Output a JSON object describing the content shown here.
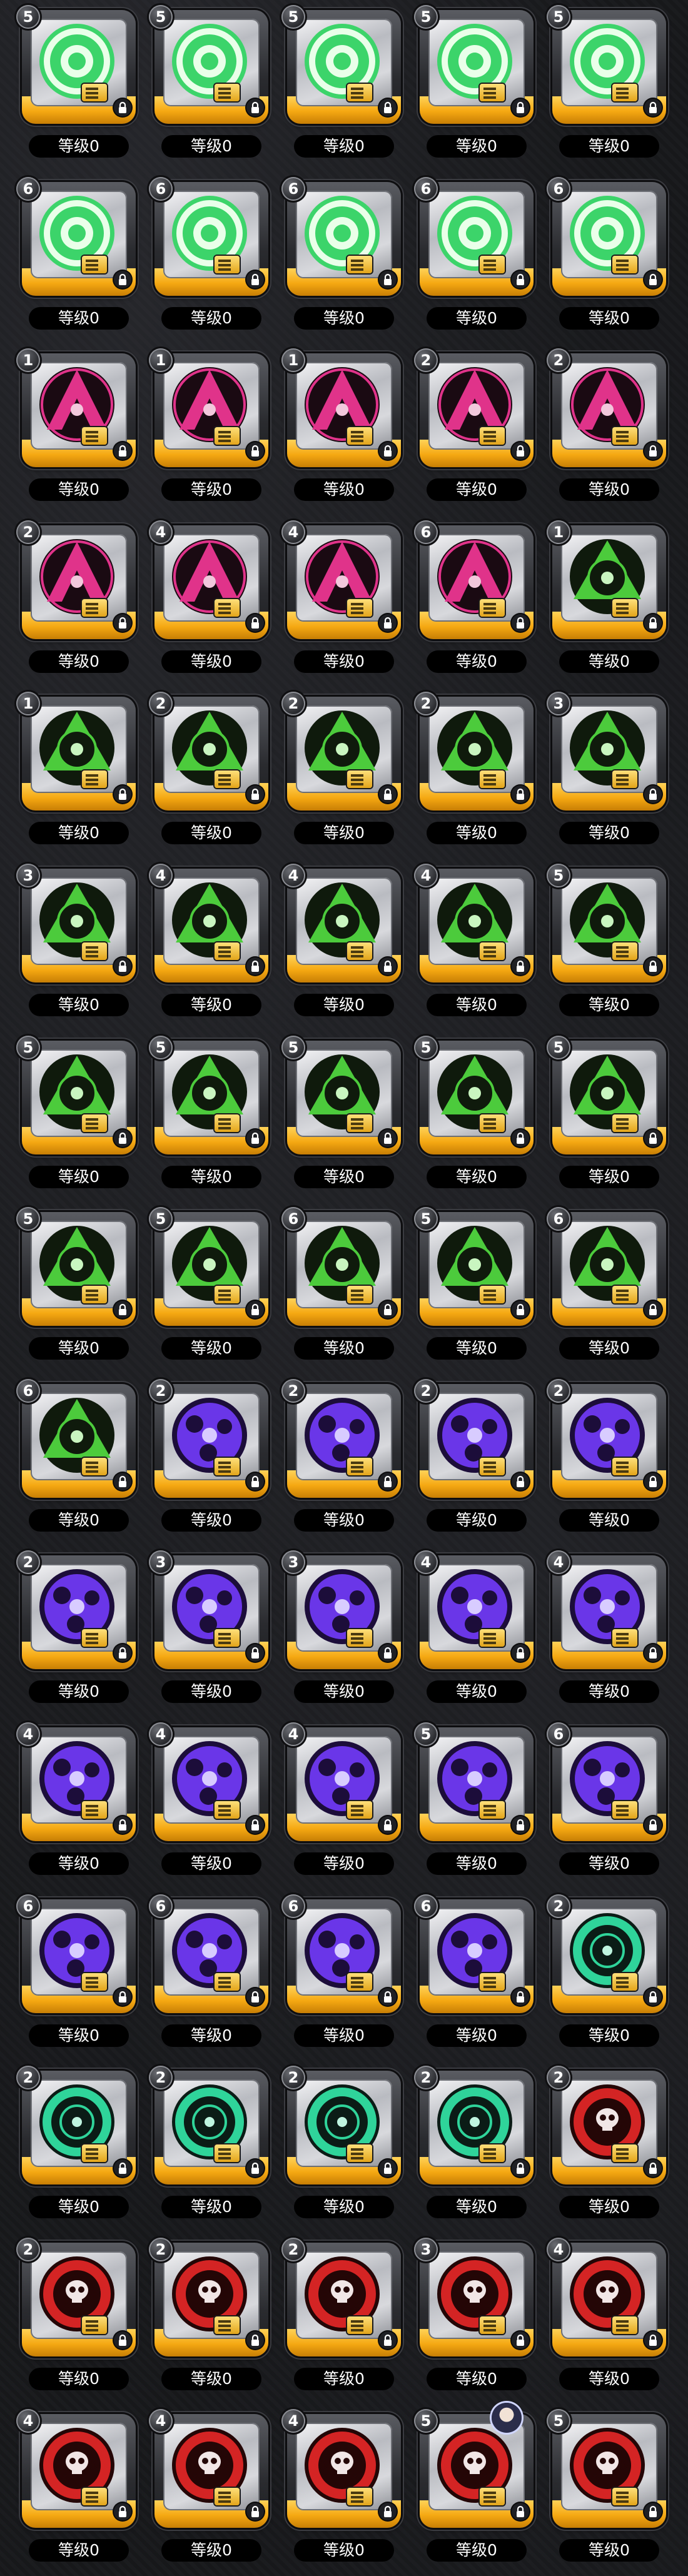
{
  "level_label": "等级0",
  "colors": {
    "green": "#3cd46a",
    "pink": "#e0338a",
    "lime": "#4ccb3c",
    "purple": "#6a36e8",
    "teal": "#2fd49a",
    "red": "#d42424"
  },
  "items": [
    {
      "badge": "5",
      "color": "green",
      "design": "plain",
      "level": "等级0"
    },
    {
      "badge": "5",
      "color": "green",
      "design": "plain",
      "level": "等级0"
    },
    {
      "badge": "5",
      "color": "green",
      "design": "plain",
      "level": "等级0"
    },
    {
      "badge": "5",
      "color": "green",
      "design": "plain",
      "level": "等级0"
    },
    {
      "badge": "5",
      "color": "green",
      "design": "plain",
      "level": "等级0"
    },
    {
      "badge": "6",
      "color": "green",
      "design": "plain",
      "level": "等级0"
    },
    {
      "badge": "6",
      "color": "green",
      "design": "plain",
      "level": "等级0"
    },
    {
      "badge": "6",
      "color": "green",
      "design": "plain",
      "level": "等级0"
    },
    {
      "badge": "6",
      "color": "green",
      "design": "plain",
      "level": "等级0"
    },
    {
      "badge": "6",
      "color": "green",
      "design": "plain",
      "level": "等级0"
    },
    {
      "badge": "1",
      "color": "pink",
      "design": "arrow",
      "level": "等级0"
    },
    {
      "badge": "1",
      "color": "pink",
      "design": "arrow",
      "level": "等级0"
    },
    {
      "badge": "1",
      "color": "pink",
      "design": "arrow",
      "level": "等级0"
    },
    {
      "badge": "2",
      "color": "pink",
      "design": "arrow",
      "level": "等级0"
    },
    {
      "badge": "2",
      "color": "pink",
      "design": "arrow",
      "level": "等级0"
    },
    {
      "badge": "2",
      "color": "pink",
      "design": "arrow",
      "level": "等级0"
    },
    {
      "badge": "4",
      "color": "pink",
      "design": "arrow",
      "level": "等级0"
    },
    {
      "badge": "4",
      "color": "pink",
      "design": "arrow",
      "level": "等级0"
    },
    {
      "badge": "6",
      "color": "pink",
      "design": "arrow",
      "level": "等级0"
    },
    {
      "badge": "1",
      "color": "lime",
      "design": "tri",
      "level": "等级0"
    },
    {
      "badge": "1",
      "color": "lime",
      "design": "tri",
      "level": "等级0"
    },
    {
      "badge": "2",
      "color": "lime",
      "design": "tri",
      "level": "等级0"
    },
    {
      "badge": "2",
      "color": "lime",
      "design": "tri",
      "level": "等级0"
    },
    {
      "badge": "2",
      "color": "lime",
      "design": "tri",
      "level": "等级0"
    },
    {
      "badge": "3",
      "color": "lime",
      "design": "tri",
      "level": "等级0"
    },
    {
      "badge": "3",
      "color": "lime",
      "design": "tri",
      "level": "等级0"
    },
    {
      "badge": "4",
      "color": "lime",
      "design": "tri",
      "level": "等级0"
    },
    {
      "badge": "4",
      "color": "lime",
      "design": "tri",
      "level": "等级0"
    },
    {
      "badge": "4",
      "color": "lime",
      "design": "tri",
      "level": "等级0"
    },
    {
      "badge": "5",
      "color": "lime",
      "design": "tri",
      "level": "等级0"
    },
    {
      "badge": "5",
      "color": "lime",
      "design": "tri",
      "level": "等级0"
    },
    {
      "badge": "5",
      "color": "lime",
      "design": "tri",
      "level": "等级0"
    },
    {
      "badge": "5",
      "color": "lime",
      "design": "tri",
      "level": "等级0"
    },
    {
      "badge": "5",
      "color": "lime",
      "design": "tri",
      "level": "等级0"
    },
    {
      "badge": "5",
      "color": "lime",
      "design": "tri",
      "level": "等级0"
    },
    {
      "badge": "5",
      "color": "lime",
      "design": "tri",
      "level": "等级0"
    },
    {
      "badge": "5",
      "color": "lime",
      "design": "tri",
      "level": "等级0"
    },
    {
      "badge": "6",
      "color": "lime",
      "design": "tri",
      "level": "等级0"
    },
    {
      "badge": "5",
      "color": "lime",
      "design": "tri",
      "level": "等级0"
    },
    {
      "badge": "6",
      "color": "lime",
      "design": "tri",
      "level": "等级0"
    },
    {
      "badge": "6",
      "color": "lime",
      "design": "tri",
      "level": "等级0"
    },
    {
      "badge": "2",
      "color": "purple",
      "design": "swirl",
      "level": "等级0"
    },
    {
      "badge": "2",
      "color": "purple",
      "design": "swirl",
      "level": "等级0"
    },
    {
      "badge": "2",
      "color": "purple",
      "design": "swirl",
      "level": "等级0"
    },
    {
      "badge": "2",
      "color": "purple",
      "design": "swirl",
      "level": "等级0"
    },
    {
      "badge": "2",
      "color": "purple",
      "design": "swirl",
      "level": "等级0"
    },
    {
      "badge": "3",
      "color": "purple",
      "design": "swirl",
      "level": "等级0"
    },
    {
      "badge": "3",
      "color": "purple",
      "design": "swirl",
      "level": "等级0"
    },
    {
      "badge": "4",
      "color": "purple",
      "design": "swirl",
      "level": "等级0"
    },
    {
      "badge": "4",
      "color": "purple",
      "design": "swirl",
      "level": "等级0"
    },
    {
      "badge": "4",
      "color": "purple",
      "design": "swirl",
      "level": "等级0"
    },
    {
      "badge": "4",
      "color": "purple",
      "design": "swirl",
      "level": "等级0"
    },
    {
      "badge": "4",
      "color": "purple",
      "design": "swirl",
      "level": "等级0"
    },
    {
      "badge": "5",
      "color": "purple",
      "design": "swirl",
      "level": "等级0"
    },
    {
      "badge": "6",
      "color": "purple",
      "design": "swirl",
      "level": "等级0"
    },
    {
      "badge": "6",
      "color": "purple",
      "design": "swirl",
      "level": "等级0"
    },
    {
      "badge": "6",
      "color": "purple",
      "design": "swirl",
      "level": "等级0"
    },
    {
      "badge": "6",
      "color": "purple",
      "design": "swirl",
      "level": "等级0"
    },
    {
      "badge": "6",
      "color": "purple",
      "design": "swirl",
      "level": "等级0"
    },
    {
      "badge": "2",
      "color": "teal",
      "design": "ring",
      "level": "等级0"
    },
    {
      "badge": "2",
      "color": "teal",
      "design": "ring",
      "level": "等级0"
    },
    {
      "badge": "2",
      "color": "teal",
      "design": "ring",
      "level": "等级0"
    },
    {
      "badge": "2",
      "color": "teal",
      "design": "ring",
      "level": "等级0"
    },
    {
      "badge": "2",
      "color": "teal",
      "design": "ring",
      "level": "等级0"
    },
    {
      "badge": "2",
      "color": "red",
      "design": "skull",
      "level": "等级0"
    },
    {
      "badge": "2",
      "color": "red",
      "design": "skull",
      "level": "等级0"
    },
    {
      "badge": "2",
      "color": "red",
      "design": "skull",
      "level": "等级0"
    },
    {
      "badge": "2",
      "color": "red",
      "design": "skull",
      "level": "等级0"
    },
    {
      "badge": "3",
      "color": "red",
      "design": "skull",
      "level": "等级0"
    },
    {
      "badge": "4",
      "color": "red",
      "design": "skull",
      "level": "等级0"
    },
    {
      "badge": "4",
      "color": "red",
      "design": "skull",
      "level": "等级0"
    },
    {
      "badge": "4",
      "color": "red",
      "design": "skull",
      "level": "等级0"
    },
    {
      "badge": "4",
      "color": "red",
      "design": "skull",
      "level": "等级0"
    },
    {
      "badge": "5",
      "color": "red",
      "design": "skull",
      "level": "等级0",
      "avatar": true
    },
    {
      "badge": "5",
      "color": "red",
      "design": "skull",
      "level": "等级0"
    }
  ]
}
